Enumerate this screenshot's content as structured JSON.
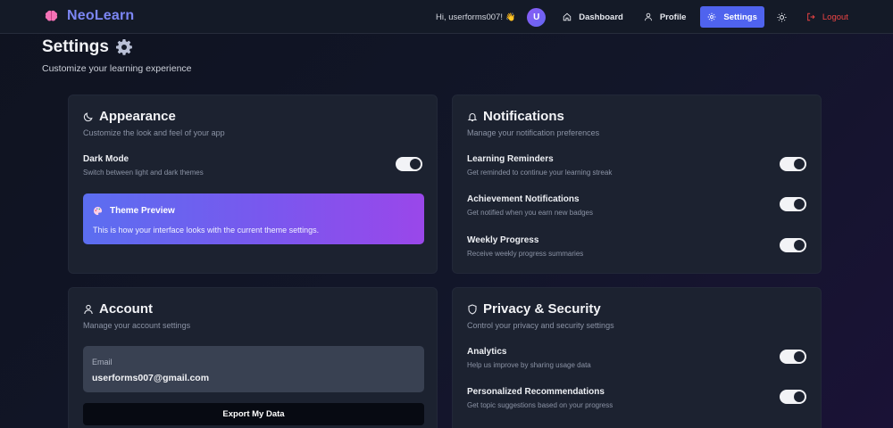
{
  "nav": {
    "brand": "NeoLearn",
    "greeting": "Hi, userforms007!",
    "greeting_emoji": "👋",
    "avatar_initial": "U",
    "dashboard": "Dashboard",
    "profile": "Profile",
    "settings": "Settings",
    "logout": "Logout",
    "accent_color": "#4f63ee",
    "logout_color": "#ef4444"
  },
  "page": {
    "title": "Settings",
    "subtitle": "Customize your learning experience"
  },
  "appearance": {
    "title": "Appearance",
    "desc": "Customize the look and feel of your app",
    "dark_mode_label": "Dark Mode",
    "dark_mode_desc": "Switch between light and dark themes",
    "dark_mode_on": true,
    "preview_title": "Theme Preview",
    "preview_text": "This is how your interface looks with the current theme settings."
  },
  "notifications": {
    "title": "Notifications",
    "desc": "Manage your notification preferences",
    "items": [
      {
        "label": "Learning Reminders",
        "desc": "Get reminded to continue your learning streak",
        "on": true
      },
      {
        "label": "Achievement Notifications",
        "desc": "Get notified when you earn new badges",
        "on": true
      },
      {
        "label": "Weekly Progress",
        "desc": "Receive weekly progress summaries",
        "on": true
      }
    ]
  },
  "account": {
    "title": "Account",
    "desc": "Manage your account settings",
    "email_label": "Email",
    "email_value": "userforms007@gmail.com",
    "export_label": "Export My Data"
  },
  "privacy": {
    "title": "Privacy & Security",
    "desc": "Control your privacy and security settings",
    "items": [
      {
        "label": "Analytics",
        "desc": "Help us improve by sharing usage data",
        "on": true
      },
      {
        "label": "Personalized Recommendations",
        "desc": "Get topic suggestions based on your progress",
        "on": true
      }
    ]
  },
  "icons": {
    "brand": "brain-icon",
    "title": "gear-icon",
    "dashboard": "home-icon",
    "profile": "user-icon",
    "settings": "gear-icon",
    "theme": "sun-icon",
    "logout": "logout-icon",
    "appearance": "moon-icon",
    "notifications": "bell-icon",
    "account": "user-icon",
    "privacy": "shield-icon",
    "preview": "palette-icon"
  }
}
